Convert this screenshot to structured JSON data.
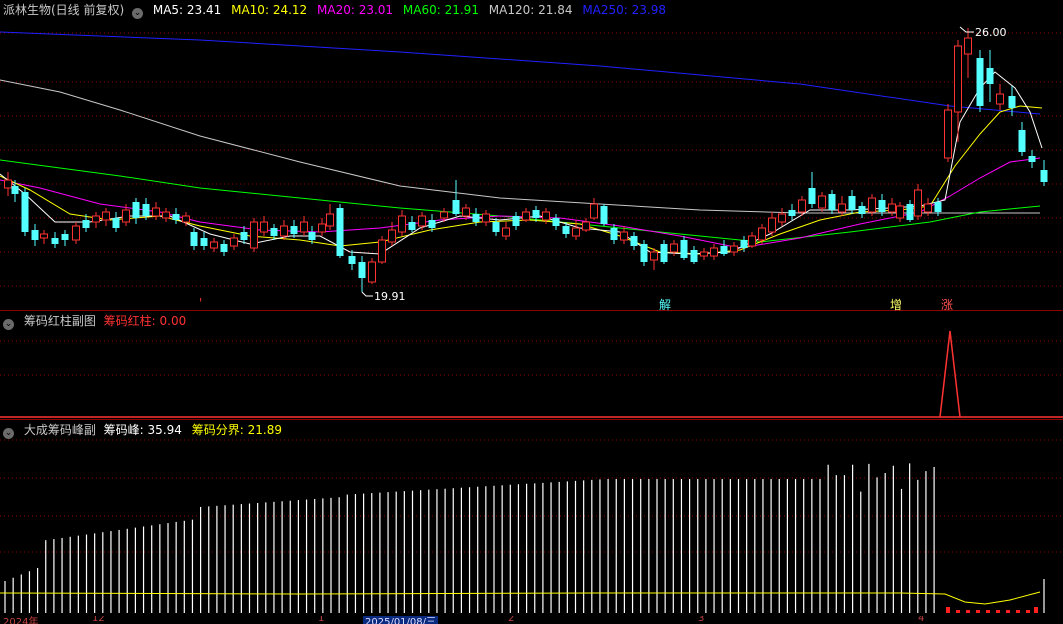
{
  "colors": {
    "up": "#ff3232",
    "down": "#54ffff",
    "ma5": "#ffffff",
    "ma10": "#ffff00",
    "ma20": "#ff00ff",
    "ma60": "#00ff00",
    "ma120": "#c8c8c8",
    "ma250": "#2020ff",
    "grid": "#8b0000",
    "bar": "#ffffff",
    "fenjie": "#ffff00"
  },
  "main": {
    "title": "派林生物(日线 前复权)",
    "ma": [
      {
        "label": "MA5:",
        "value": "23.41",
        "color": "#ffffff"
      },
      {
        "label": "MA10:",
        "value": "24.12",
        "color": "#ffff00"
      },
      {
        "label": "MA20:",
        "value": "23.01",
        "color": "#ff00ff"
      },
      {
        "label": "MA60:",
        "value": "21.91",
        "color": "#00ff00"
      },
      {
        "label": "MA120:",
        "value": "21.84",
        "color": "#c8c8c8"
      },
      {
        "label": "MA250:",
        "value": "23.98",
        "color": "#2020ff"
      }
    ],
    "high_label": "26.00",
    "low_label": "19.91",
    "signals": [
      {
        "text": "'",
        "color": "#ff3232"
      },
      {
        "text": "解",
        "color": "#54ffff"
      },
      {
        "text": "增",
        "color": "#ffff66"
      },
      {
        "text": "涨",
        "color": "#ff5050"
      }
    ]
  },
  "sub1": {
    "title": "筹码红柱副图",
    "label": "筹码红柱:",
    "value": "0.00"
  },
  "sub2": {
    "title": "大成筹码峰副",
    "label1": "筹码峰:",
    "value1": "35.94",
    "label2": "筹码分界:",
    "value2": "21.89"
  },
  "xaxis": [
    "2024年",
    "12",
    "1",
    "2025/01/08/三",
    "2",
    "3",
    "4"
  ]
}
